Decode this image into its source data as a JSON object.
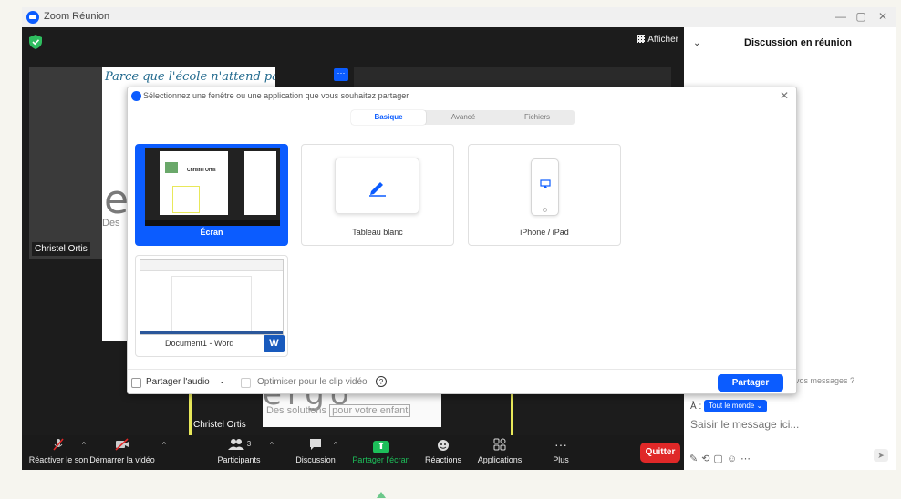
{
  "window": {
    "title": "Zoom Réunion",
    "minimize": "—",
    "maximize": "▢",
    "close": "✕"
  },
  "meeting": {
    "view_button": "Afficher",
    "shared_headline": "Parce que l'école n'attend pas",
    "more_button": "···",
    "ergo_letter": "e",
    "des_fragment": "Des",
    "participant_left_name": "Christel Ortis",
    "selfview": {
      "brand": "ergo",
      "tagline_part1": "Des solutions",
      "tagline_part2": "pour votre enfant",
      "name": "Christel Ortis"
    }
  },
  "toolbar": {
    "items": [
      {
        "label": "Réactiver le son",
        "icon": "muted-mic-icon"
      },
      {
        "label": "Démarrer la vidéo",
        "icon": "video-off-icon"
      },
      {
        "label": "Participants",
        "icon": "participants-icon",
        "count": "3"
      },
      {
        "label": "Discussion",
        "icon": "chat-bubble-icon"
      },
      {
        "label": "Partager l'écran",
        "icon": "share-screen-icon"
      },
      {
        "label": "Réactions",
        "icon": "reactions-icon"
      },
      {
        "label": "Applications",
        "icon": "apps-icon"
      },
      {
        "label": "Plus",
        "icon": "more-icon"
      }
    ],
    "quit_label": "Quitter",
    "colors": {
      "share": "#1dbf5a",
      "quit": "#e02828"
    }
  },
  "chat": {
    "title": "Discussion en réunion",
    "question": "vos messages ?",
    "to_label": "À :",
    "recipient": "Tout le monde",
    "input_placeholder": "Saisir le message ici..."
  },
  "dialog": {
    "title": "Sélectionnez une fenêtre ou une application que vous souhaitez partager",
    "tabs": [
      {
        "label": "Basique",
        "active": true
      },
      {
        "label": "Avancé",
        "active": false
      },
      {
        "label": "Fichiers",
        "active": false
      }
    ],
    "options": [
      {
        "label": "Écran",
        "selected": true
      },
      {
        "label": "Tableau blanc",
        "selected": false
      },
      {
        "label": "iPhone / iPad",
        "selected": false
      },
      {
        "label": "Document1 - Word",
        "selected": false
      }
    ],
    "thumb_name": "Christel Ortis",
    "word_badge": "W",
    "share_audio_label": "Partager l'audio",
    "optimize_label": "Optimiser pour le clip vidéo",
    "share_button": "Partager",
    "accent": "#0b5cff"
  }
}
